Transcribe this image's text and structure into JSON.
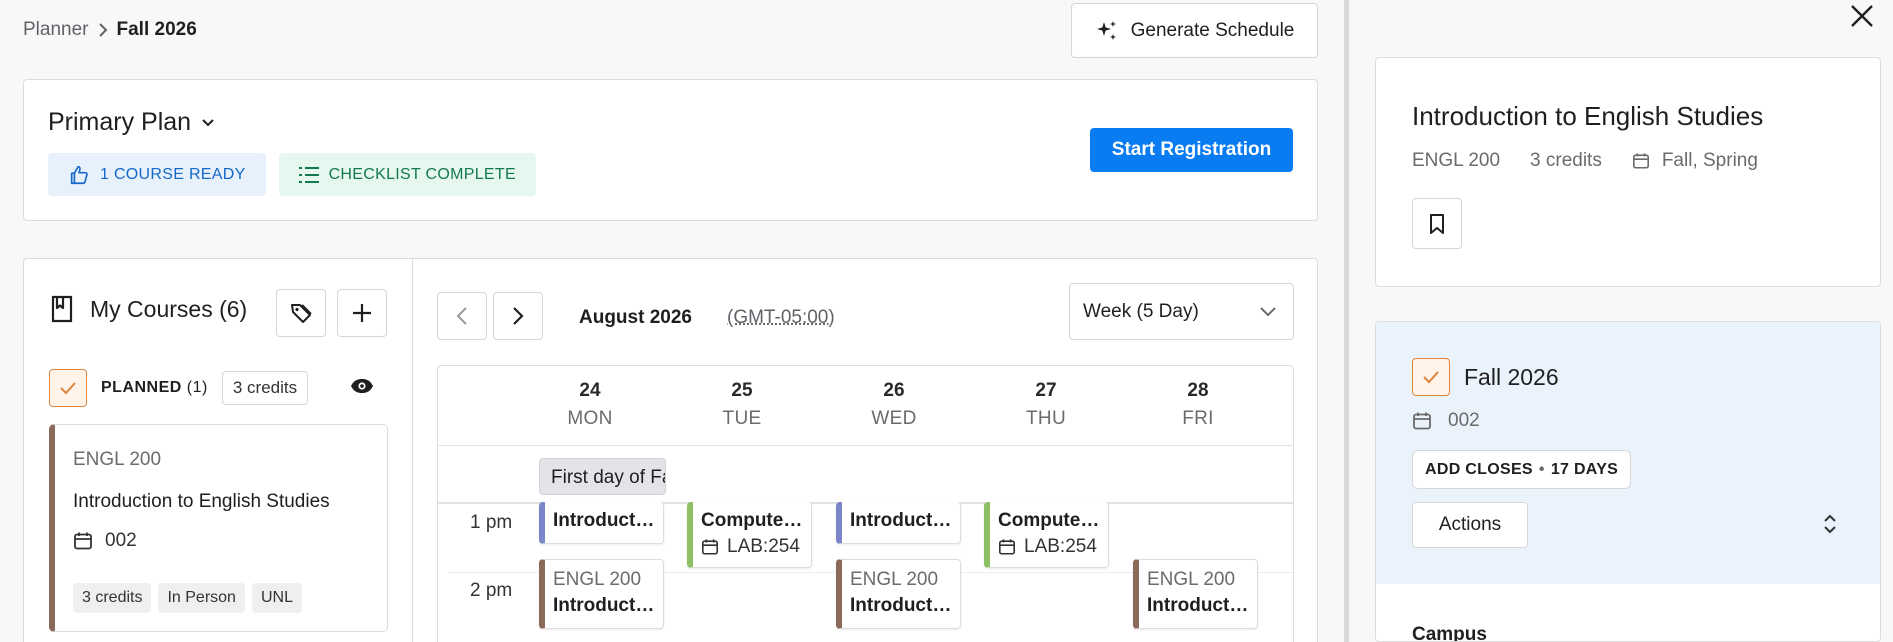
{
  "breadcrumb": {
    "parent": "Planner",
    "current": "Fall 2026"
  },
  "header": {
    "generate_label": "Generate Schedule"
  },
  "plan": {
    "title": "Primary Plan",
    "badge_ready": "1 COURSE READY",
    "badge_checklist": "CHECKLIST COMPLETE",
    "start_label": "Start Registration"
  },
  "my_courses": {
    "title": "My Courses (6)",
    "planned_label": "PLANNED",
    "planned_count": "(1)",
    "planned_credits": "3 credits",
    "course": {
      "code": "ENGL 200",
      "title": "Introduction to English Studies",
      "section": "002",
      "tags": [
        "3 credits",
        "In Person",
        "UNL"
      ]
    }
  },
  "calendar": {
    "month": "August 2026",
    "timezone": "(GMT-05:00)",
    "view": "Week (5 Day)",
    "days": [
      {
        "num": "24",
        "name": "MON"
      },
      {
        "num": "25",
        "name": "TUE"
      },
      {
        "num": "26",
        "name": "WED"
      },
      {
        "num": "27",
        "name": "THU"
      },
      {
        "num": "28",
        "name": "FRI"
      }
    ],
    "all_day_event": "First day of Fall",
    "times": [
      "1 pm",
      "2 pm"
    ],
    "events": {
      "mon_top": "Introduction to English Studies",
      "tue_title": "Computer Science Lab",
      "tue_loc": "LAB:254",
      "wed_top": "Introduction to English Studies",
      "thu_title": "Computer Science Lab",
      "thu_loc": "LAB:254",
      "mon_code": "ENGL 200",
      "mon_title": "Introduction to English Studies",
      "wed_code": "ENGL 200",
      "wed_title": "Introduction to English Studies",
      "fri_code": "ENGL 200",
      "fri_title": "Introduction to English Studies"
    }
  },
  "panel": {
    "title": "Introduction to English Studies",
    "code": "ENGL 200",
    "credits": "3 credits",
    "terms": "Fall, Spring",
    "term": {
      "name": "Fall 2026",
      "section": "002",
      "add_closes_label": "ADD CLOSES",
      "add_closes_value": "17 DAYS",
      "actions_label": "Actions",
      "campus_label": "Campus"
    }
  },
  "colors": {
    "primary": "#0a7cf2",
    "planned_accent": "#e0843a",
    "course_engl": "#8b6a5a",
    "event_blue": "#7a86c9",
    "event_green": "#8cc063",
    "term_bg": "#eaf3fc"
  }
}
